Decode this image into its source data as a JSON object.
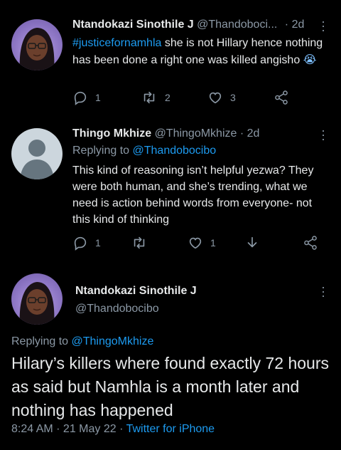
{
  "tweet1": {
    "display_name": "Ntandokazi Sinothile J",
    "handle": "@Thandoboci...",
    "time": "· 2d",
    "hashtag": "#justicefornamhla",
    "text": " she is not Hillary hence nothing has been done a right one was killed angisho",
    "emoji": "😭",
    "reply_count": "1",
    "retweet_count": "2",
    "like_count": "3"
  },
  "tweet2": {
    "display_name": "Thingo Mkhize",
    "handle": "@ThingoMkhize",
    "time": "· 2d",
    "replying_prefix": "Replying to ",
    "replying_to": "@Thandobocibo",
    "text": "This kind of reasoning isn’t helpful yezwa? They were both human, and she’s trending, what we need is action behind words from everyone- not this kind of thinking",
    "reply_count": "1",
    "like_count": "1"
  },
  "tweet3": {
    "display_name": "Ntandokazi Sinothile J",
    "handle": "@Thandobocibo",
    "replying_prefix": "Replying to ",
    "replying_to": "@ThingoMkhize",
    "text": "Hilary’s killers where found exactly 72 hours as said but Namhla is a month later and nothing has happened",
    "time": "8:24 AM",
    "sep1": " · ",
    "date": "21 May 22",
    "sep2": " · ",
    "source": "Twitter for iPhone"
  },
  "colors": {
    "background": "#000000",
    "text": "#e7e9ea",
    "muted": "#8b98a5",
    "link": "#1d9bf0"
  }
}
